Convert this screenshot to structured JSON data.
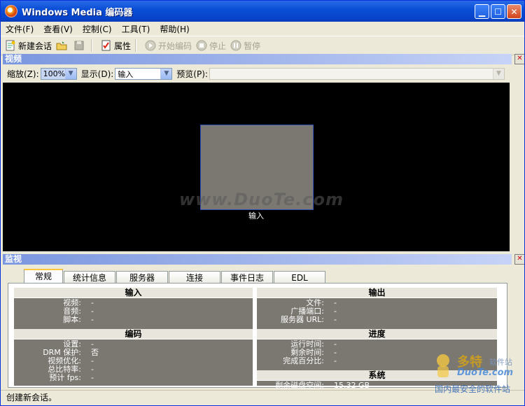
{
  "window": {
    "title": "Windows Media 编码器"
  },
  "menu": [
    "文件(F)",
    "查看(V)",
    "控制(C)",
    "工具(T)",
    "帮助(H)"
  ],
  "toolbar": {
    "new_session": "新建会话",
    "properties": "属性",
    "start_encoding": "开始编码",
    "stop": "停止",
    "pause": "暂停"
  },
  "video_panel": {
    "title": "视频",
    "zoom_label": "缩放(Z):",
    "zoom_value": "100%",
    "display_label": "显示(D):",
    "display_value": "输入",
    "preview_label": "预览(P):",
    "preview_value": "",
    "input_caption": "输入",
    "watermark": "www.DuoTe.com"
  },
  "monitor_panel": {
    "title": "监视",
    "tabs": [
      "常规",
      "统计信息",
      "服务器",
      "连接",
      "事件日志",
      "EDL"
    ],
    "active_tab": "常规",
    "input": {
      "title": "输入",
      "rows": [
        [
          "视频:",
          "-"
        ],
        [
          "音频:",
          "-"
        ],
        [
          "脚本:",
          "-"
        ]
      ]
    },
    "output": {
      "title": "输出",
      "rows": [
        [
          "文件:",
          "-"
        ],
        [
          "广播端口:",
          "-"
        ],
        [
          "服务器 URL:",
          "-"
        ]
      ]
    },
    "encode": {
      "title": "编码",
      "rows": [
        [
          "设置:",
          "-"
        ],
        [
          "DRM 保护:",
          "否"
        ],
        [
          "视频优化:",
          "-"
        ],
        [
          "总比特率:",
          "-"
        ],
        [
          "预计 fps:",
          "-"
        ]
      ]
    },
    "progress": {
      "title": "进度",
      "rows": [
        [
          "运行时间:",
          "-"
        ],
        [
          "剩余时间:",
          "-"
        ],
        [
          "完成百分比:",
          "-"
        ]
      ]
    },
    "system": {
      "title": "系统",
      "rows": [
        [
          "剩余磁盘空间:",
          "15.32 GB"
        ]
      ]
    }
  },
  "status": {
    "text": "创建新会话。"
  },
  "brand": {
    "name": "多特",
    "sub": "软件站",
    "url": "DuoTe.com",
    "slogan": "国内最安全的软件站"
  }
}
